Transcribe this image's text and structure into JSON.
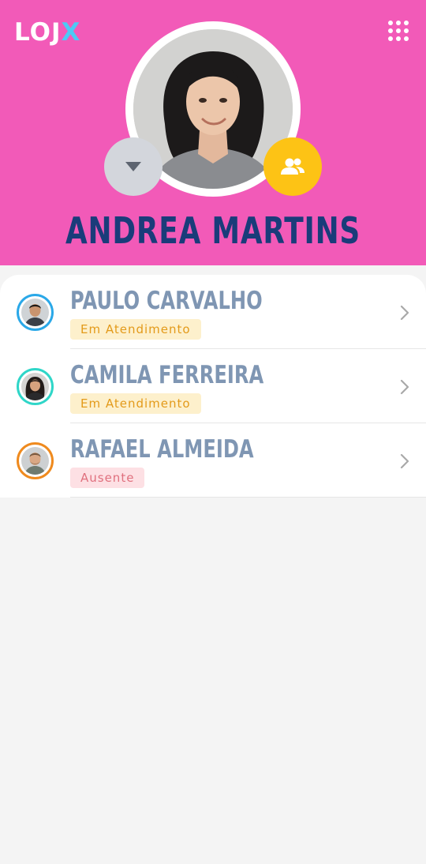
{
  "app": {
    "logo_main": "LOJ",
    "logo_accent": "X",
    "accent_color": "#4cc9f5",
    "header_color": "#f25ab8"
  },
  "profile": {
    "name": "ANDREA MARTINS",
    "menu_icon": "grid-menu-icon",
    "dropdown_icon": "caret-down-icon",
    "group_icon": "group-users-icon"
  },
  "contacts": [
    {
      "name": "PAULO CARVALHO",
      "status": "Em Atendimento",
      "status_type": "busy",
      "ring_color": "#2aa8e8"
    },
    {
      "name": "CAMILA FERREIRA",
      "status": "Em Atendimento",
      "status_type": "busy",
      "ring_color": "#2fd6c8"
    },
    {
      "name": "RAFAEL ALMEIDA",
      "status": "Ausente",
      "status_type": "away",
      "ring_color": "#ef8a1e"
    }
  ]
}
